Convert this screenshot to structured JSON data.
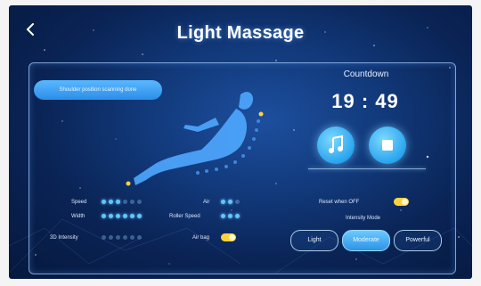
{
  "header": {
    "title": "Light Massage"
  },
  "status": {
    "text": "Shoulder position scanning done"
  },
  "countdown": {
    "label": "Countdown",
    "value": "19 : 49"
  },
  "controls": [
    {
      "label": "Speed",
      "level": 3,
      "max": 6
    },
    {
      "label": "Width",
      "level": 6,
      "max": 6
    },
    {
      "label": "3D Intensity",
      "level": 0,
      "max": 6
    },
    {
      "label": "Air",
      "level": 2,
      "max": 3
    },
    {
      "label": "Roller Speed",
      "level": 3,
      "max": 3
    }
  ],
  "toggles": {
    "air_bag": {
      "label": "Air bag",
      "on": true
    },
    "reset": {
      "label": "Reset when OFF",
      "on": true
    }
  },
  "intensity": {
    "label": "Intensity Mode",
    "options": [
      "Light",
      "Moderate",
      "Powerful"
    ],
    "selected": "Moderate"
  },
  "colors": {
    "accent": "#2aa5ee",
    "highlight": "#ffd23c",
    "background": "#0a2456"
  },
  "icons": {
    "back": "chevron-left-icon",
    "music": "music-icon",
    "stop": "stop-icon"
  }
}
